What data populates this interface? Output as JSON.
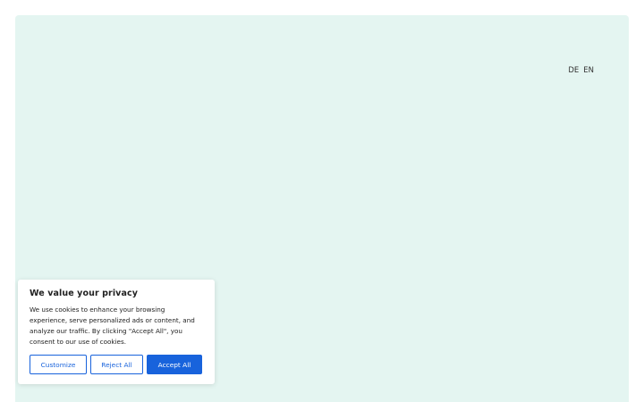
{
  "language_switcher": {
    "items": [
      {
        "label": "DE"
      },
      {
        "label": "EN"
      }
    ]
  },
  "cookie_banner": {
    "title": "We value your privacy",
    "description": "We use cookies to enhance your browsing experience, serve personalized ads or content, and analyze our traffic. By clicking \"Accept All\", you consent to our use of cookies.",
    "buttons": {
      "customize": "Customize",
      "reject_all": "Reject All",
      "accept_all": "Accept All"
    }
  },
  "colors": {
    "page_background": "#e4f5f1",
    "accent": "#1863dc"
  }
}
